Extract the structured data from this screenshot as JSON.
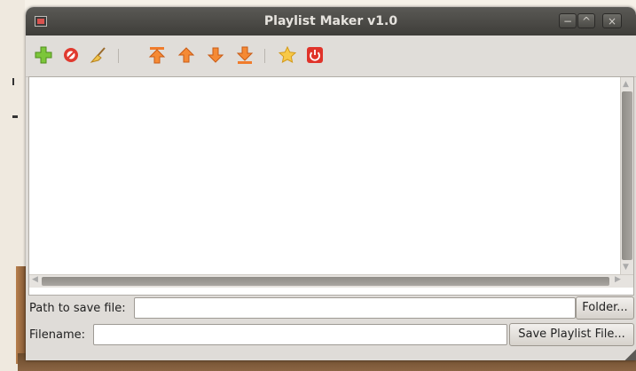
{
  "window": {
    "title": "Playlist Maker v1.0",
    "controls": {
      "minimize": "−",
      "maximize": "^",
      "close": "×"
    }
  },
  "toolbar": {
    "items": [
      {
        "icon": "add-icon",
        "color": "#6fbf2a"
      },
      {
        "icon": "remove-icon",
        "color": "#e03a2f"
      },
      {
        "icon": "broom-clear-icon",
        "color": "#e8b83a"
      },
      {
        "icon": "move-top-icon",
        "color": "#f07c2b"
      },
      {
        "icon": "move-up-icon",
        "color": "#f07c2b"
      },
      {
        "icon": "move-down-icon",
        "color": "#f07c2b"
      },
      {
        "icon": "move-bottom-icon",
        "color": "#f07c2b"
      },
      {
        "icon": "star-icon",
        "color": "#f5c242"
      },
      {
        "icon": "power-quit-icon",
        "color": "#e0332a"
      }
    ]
  },
  "playlist": {
    "items": []
  },
  "form": {
    "path_label": "Path to save file:",
    "path_value": "",
    "folder_button": "Folder...",
    "filename_label": "Filename:",
    "filename_value": "",
    "save_button": "Save Playlist File..."
  }
}
